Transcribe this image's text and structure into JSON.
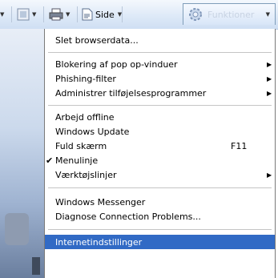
{
  "toolbar": {
    "page_label": "Side",
    "tools_label": "Funktioner",
    "icons": [
      "home-icon",
      "feeds-icon",
      "print-icon",
      "page-icon",
      "tools-gear-icon"
    ]
  },
  "menu": {
    "clear_history": "Slet browserdata...",
    "popup_blocker": "Blokering af pop op-vinduer",
    "phishing_filter": "Phishing-filter",
    "manage_addons": "Administrer tilføjelsesprogrammer",
    "work_offline": "Arbejd offline",
    "windows_update": "Windows Update",
    "full_screen": "Fuld skærm",
    "full_screen_shortcut": "F11",
    "menu_bar": "Menulinje",
    "toolbars": "Værktøjslinjer",
    "messenger": "Windows Messenger",
    "diagnose": "Diagnose Connection Problems...",
    "internet_options": "Internetindstillinger"
  },
  "colors": {
    "highlight": "#316ac5",
    "toolbar_bg": "#dce8f7"
  }
}
